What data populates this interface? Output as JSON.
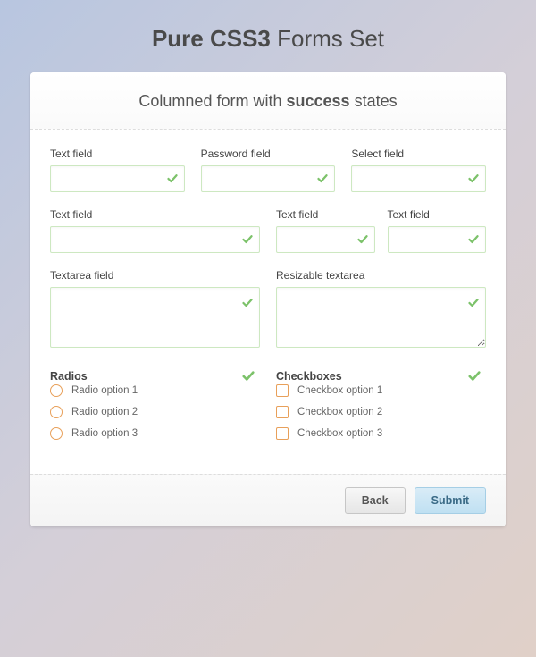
{
  "colors": {
    "success_border": "#cde8c1",
    "success_check": "#7cc26a",
    "accent_option": "#e8a05a"
  },
  "page_title": {
    "bold": "Pure CSS3",
    "rest": "Forms Set"
  },
  "card_header": {
    "pre": "Columned form with",
    "bold": "success",
    "post": "states"
  },
  "fields": {
    "text1": {
      "label": "Text field",
      "value": ""
    },
    "password": {
      "label": "Password field",
      "value": ""
    },
    "select": {
      "label": "Select field",
      "value": ""
    },
    "text2": {
      "label": "Text field",
      "value": ""
    },
    "text3": {
      "label": "Text field",
      "value": ""
    },
    "text4": {
      "label": "Text field",
      "value": ""
    },
    "textarea1": {
      "label": "Textarea field",
      "value": ""
    },
    "textarea2": {
      "label": "Resizable textarea",
      "value": ""
    }
  },
  "radios": {
    "label": "Radios",
    "options": [
      "Radio option 1",
      "Radio option 2",
      "Radio option 3"
    ]
  },
  "checkboxes": {
    "label": "Checkboxes",
    "options": [
      "Checkbox option 1",
      "Checkbox option 2",
      "Checkbox option 3"
    ]
  },
  "buttons": {
    "back": "Back",
    "submit": "Submit"
  }
}
